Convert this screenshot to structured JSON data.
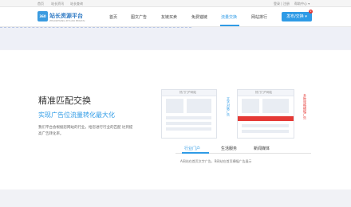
{
  "topbar": {
    "left_links": [
      "首页",
      "站长资讯",
      "站长查询"
    ],
    "right_links": [
      "登录 | 注册",
      "帮助中心 ▾"
    ]
  },
  "header": {
    "logo_badge": "360",
    "logo_text": "站长资源平台",
    "logo_sub": "ZHANZHANG ZIYUAN PINGTAI",
    "nav": [
      "首页",
      "图文广告",
      "友链买卖",
      "免费锚链",
      "流量交换",
      "网站排行"
    ],
    "active_nav": "流量交换",
    "cta_label": "发布/交换 ▾",
    "cta_badge": "9"
  },
  "hero": {
    "title": "精准匹配交换",
    "subtitle": "实现广告位流量转化最大化",
    "description": "我们平台会根据您网站的行业，给您进行行业的匹配 达到提高广告转化率。"
  },
  "illustration": {
    "left_frame_title": "热门门户网站",
    "right_frame_title": "热门门户网站",
    "left_vertical_text": "文字对联广告",
    "right_vertical_text": "多种规格横幅广告"
  },
  "tabs": {
    "items": [
      "行业门户",
      "生活服务",
      "新闻媒体"
    ],
    "active": "行业门户",
    "active_description": "A网站在首页文字广告，B网站在首页横幅广告展示"
  },
  "colors": {
    "accent": "#2f9be6",
    "ad_red": "#e53935"
  }
}
